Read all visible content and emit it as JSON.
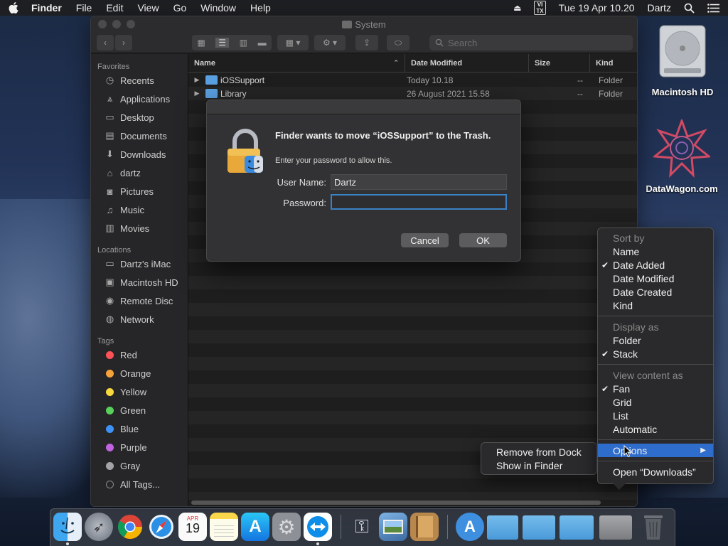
{
  "menubar": {
    "app": "Finder",
    "items": [
      "File",
      "Edit",
      "View",
      "Go",
      "Window",
      "Help"
    ],
    "badge": "VI\nTX",
    "clock": "Tue 19 Apr  10.20",
    "user": "Dartz"
  },
  "window": {
    "title": "System",
    "search_placeholder": "Search"
  },
  "sidebar": {
    "favorites_label": "Favorites",
    "favorites": [
      "Recents",
      "Applications",
      "Desktop",
      "Documents",
      "Downloads",
      "dartz",
      "Pictures",
      "Music",
      "Movies"
    ],
    "locations_label": "Locations",
    "locations": [
      "Dartz's iMac",
      "Macintosh HD",
      "Remote Disc",
      "Network"
    ],
    "tags_label": "Tags",
    "tags": [
      {
        "name": "Red",
        "color": "#ff5257"
      },
      {
        "name": "Orange",
        "color": "#f7a33c"
      },
      {
        "name": "Yellow",
        "color": "#f9d93d"
      },
      {
        "name": "Green",
        "color": "#58d15a"
      },
      {
        "name": "Blue",
        "color": "#3f92f5"
      },
      {
        "name": "Purple",
        "color": "#c163e0"
      },
      {
        "name": "Gray",
        "color": "#a4a4a8"
      }
    ],
    "all_tags": "All Tags..."
  },
  "columns": {
    "name": "Name",
    "date": "Date Modified",
    "size": "Size",
    "kind": "Kind"
  },
  "files": [
    {
      "name": "iOSSupport",
      "date": "Today 10.18",
      "size": "--",
      "kind": "Folder"
    },
    {
      "name": "Library",
      "date": "26 August 2021 15.58",
      "size": "--",
      "kind": "Folder"
    }
  ],
  "dialog": {
    "heading": "Finder wants to move “iOSSupport” to the Trash.",
    "subtext": "Enter your password to allow this.",
    "user_label": "User Name:",
    "user_value": "Dartz",
    "password_label": "Password:",
    "password_value": "",
    "cancel": "Cancel",
    "ok": "OK"
  },
  "stack_menu": {
    "sort_by": "Sort by",
    "sort_items": [
      "Name",
      "Date Added",
      "Date Modified",
      "Date Created",
      "Kind"
    ],
    "display_as": "Display as",
    "display_items": [
      "Folder",
      "Stack"
    ],
    "view_as": "View content as",
    "view_items": [
      "Fan",
      "Grid",
      "List",
      "Automatic"
    ],
    "options": "Options",
    "open": "Open “Downloads”"
  },
  "options_submenu": [
    "Remove from Dock",
    "Show in Finder"
  ],
  "desktop": {
    "hd_label": "Macintosh HD",
    "dw_label": "DataWagon.com"
  },
  "dock": {
    "calendar_month": "APR",
    "calendar_day": "19"
  }
}
